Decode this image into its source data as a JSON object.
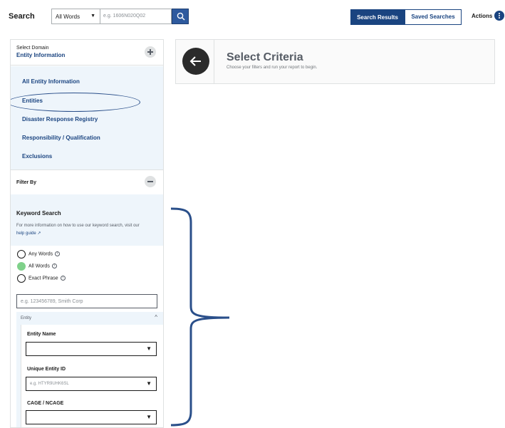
{
  "search": {
    "label": "Search",
    "scope_value": "All Words",
    "placeholder": "e.g. 1606N020Q02"
  },
  "header_tabs": {
    "results": "Search Results",
    "saved": "Saved Searches",
    "actions": "Actions"
  },
  "domain": {
    "sub": "Select Domain",
    "title": "Entity Information",
    "items": [
      {
        "label": "All Entity Information"
      },
      {
        "label": "Entities"
      },
      {
        "label": "Disaster Response Registry"
      },
      {
        "label": "Responsibility / Qualification"
      },
      {
        "label": "Exclusions"
      }
    ]
  },
  "filter": {
    "label": "Filter By",
    "keyword_title": "Keyword Search",
    "help_text": "For more information on how to use our keyword search, visit our",
    "help_link": "help guide",
    "options": [
      {
        "label": "Any Words",
        "selected": false
      },
      {
        "label": "All Words",
        "selected": true
      },
      {
        "label": "Exact Phrase",
        "selected": false
      }
    ],
    "keyword_placeholder": "e.g. 123456789, Smith Corp",
    "entity_section": "Entity",
    "fields": [
      {
        "label": "Entity Name",
        "placeholder": ""
      },
      {
        "label": "Unique Entity ID",
        "placeholder": "e.g. HTYR9UHK6SL"
      },
      {
        "label": "CAGE / NCAGE",
        "placeholder": ""
      }
    ]
  },
  "criteria": {
    "title": "Select Criteria",
    "subtitle": "Choose your filters and run your report to begin."
  },
  "colors": {
    "primary": "#1a4480",
    "panel_bg": "#eef5fb",
    "selected_radio": "#7fd18a",
    "annotation": "#2a4f8a"
  }
}
